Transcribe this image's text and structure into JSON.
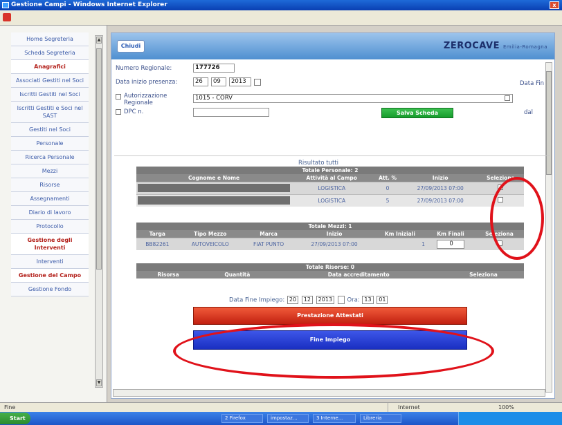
{
  "window": {
    "title": "Gestione Campi - Windows Internet Explorer",
    "close_label": "x"
  },
  "left_menu": {
    "items": [
      {
        "label": "Home Segreteria",
        "group": false
      },
      {
        "label": "Scheda Segreteria",
        "group": false
      },
      {
        "label": "Anagrafici",
        "group": true
      },
      {
        "label": "Associati Gestiti nel Soci",
        "group": false
      },
      {
        "label": "Iscritti Gestiti nel Soci",
        "group": false
      },
      {
        "label": "Iscritti Gestiti e Soci nel SAST",
        "group": false
      },
      {
        "label": "Gestiti nel Soci",
        "group": false
      },
      {
        "label": "Personale",
        "group": false
      },
      {
        "label": "Ricerca Personale",
        "group": false
      },
      {
        "label": "Mezzi",
        "group": false
      },
      {
        "label": "Risorse",
        "group": false
      },
      {
        "label": "Assegnamenti",
        "group": false
      },
      {
        "label": "Diario di lavoro",
        "group": false
      },
      {
        "label": "Protocollo",
        "group": false
      },
      {
        "label": "Gestione degli Interventi",
        "group": true
      },
      {
        "label": "Interventi",
        "group": false
      },
      {
        "label": "Gestione del Campo",
        "group": true
      },
      {
        "label": "Gestione Fondo",
        "group": false
      }
    ]
  },
  "header": {
    "tab_label": "Chiudi",
    "logo": "ZEROCAVE",
    "logo_small": "Emilia-Romagna"
  },
  "form": {
    "numero_label": "Numero Regionale:",
    "numero_value": "177726",
    "data_label": "Data inizio presenza:",
    "data_day": "26",
    "data_month": "09",
    "data_year": "2013",
    "data_fine_label": "Data Fin",
    "auto_label": "Autorizzazione Regionale",
    "auto_value": "1015 - CORV",
    "dpc_label": "DPC n.",
    "dpc_value": "",
    "dal_label": "dal",
    "salva_label": "Salva Scheda"
  },
  "results": {
    "title": "Risultato tutti",
    "personale": {
      "section": "Totale Personale: 2",
      "headers": [
        "Cognome e Nome",
        "Attività al Campo",
        "Att. %",
        "Inizio",
        "Seleziona"
      ],
      "rows": [
        {
          "attivita": "LOGISTICA",
          "perc": "0",
          "inizio": "27/09/2013 07:00"
        },
        {
          "attivita": "LOGISTICA",
          "perc": "5",
          "inizio": "27/09/2013 07:00"
        }
      ]
    },
    "mezzi": {
      "section": "Totale Mezzi: 1",
      "headers": [
        "Targa",
        "Tipo Mezzo",
        "Marca",
        "Inizio",
        "Km Iniziali",
        "Km Finali",
        "Seleziona"
      ],
      "rows": [
        {
          "targa": "BB82261",
          "tipo": "AUTOVEICOLO",
          "marca": "FIAT PUNTO",
          "inizio": "27/09/2013 07:00",
          "km_iniziali": "1",
          "km_finali": "0"
        }
      ]
    },
    "risorse": {
      "section": "Totale Risorse: 0",
      "headers": [
        "Risorsa",
        "Quantità",
        "Data accreditamento",
        "Seleziona"
      ]
    }
  },
  "data_fine": {
    "label": "Data Fine Impiego:",
    "day": "20",
    "month": "12",
    "year": "2013",
    "ora_label": "Ora:",
    "hour": "13",
    "minute": "01"
  },
  "buttons": {
    "red": "Prestazione Attestati",
    "blue": "Fine Impiego"
  },
  "status": {
    "left": "Fine",
    "internet": "Internet",
    "zoom": "100%"
  },
  "taskbar": {
    "start": "Start",
    "items": [
      "2 Firefox",
      "impostaz...",
      "3 Interne...",
      "Libreria"
    ]
  },
  "colors": {
    "annotation": "#e0121a",
    "accent": "#1a2fc2",
    "danger": "#c22010",
    "success": "#169c2c"
  }
}
